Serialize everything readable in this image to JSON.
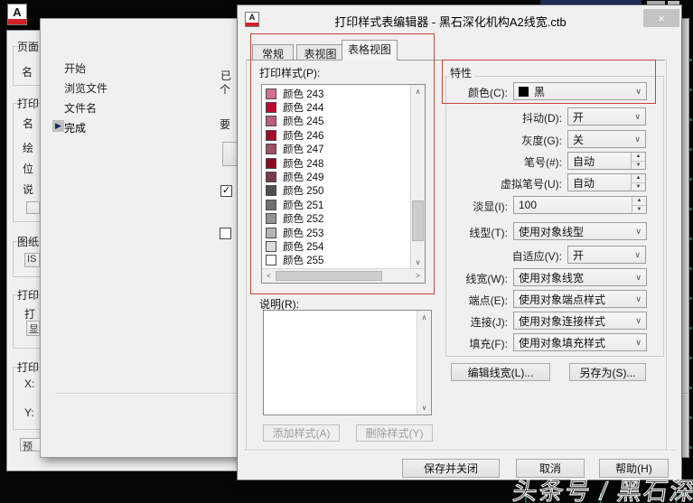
{
  "colors": {
    "annotation_red": "#c6443c",
    "dialog_bg": "#f0f0f0",
    "backdrop": "#060606",
    "tick_green": "#1d5f53"
  },
  "icons": {
    "close": "×",
    "chevron_down": "∨",
    "chevron_up": "∧",
    "chevron_left": "<",
    "chevron_right": ">",
    "spin_up": "▲",
    "spin_down": "▼",
    "current_step_arrow": "▶",
    "checkmark": "✓",
    "black_swatch": "■",
    "app_letter": "A"
  },
  "watermark": "头条号 / 黑石深化",
  "editor_dialog": {
    "title": "打印样式表编辑器 - 黑石深化机构A2线宽.ctb",
    "tabs": [
      {
        "label": "常规",
        "active": false
      },
      {
        "label": "表视图",
        "active": false
      },
      {
        "label": "表格视图",
        "active": true
      }
    ],
    "plot_styles_label": "打印样式(P):",
    "styles": [
      {
        "name": "颜色 243",
        "swatch": "#d4708e"
      },
      {
        "name": "颜色 244",
        "swatch": "#bd0a30"
      },
      {
        "name": "颜色 245",
        "swatch": "#b95f77"
      },
      {
        "name": "颜色 246",
        "swatch": "#a60a28"
      },
      {
        "name": "颜色 247",
        "swatch": "#a04f62"
      },
      {
        "name": "颜色 248",
        "swatch": "#8c0a22"
      },
      {
        "name": "颜色 249",
        "swatch": "#7a3a46"
      },
      {
        "name": "颜色 250",
        "swatch": "#4f4f4f"
      },
      {
        "name": "颜色 251",
        "swatch": "#707070"
      },
      {
        "name": "颜色 252",
        "swatch": "#949494"
      },
      {
        "name": "颜色 253",
        "swatch": "#b5b5b5"
      },
      {
        "name": "颜色 254",
        "swatch": "#dcdcdc"
      },
      {
        "name": "颜色 255",
        "swatch": "#ffffff"
      }
    ],
    "description_label": "说明(R):",
    "description_value": "",
    "add_style_button": "添加样式(A)",
    "delete_style_button": "删除样式(Y)",
    "properties": {
      "group_label": "特性",
      "rows": [
        {
          "label": "颜色(C):",
          "value": "黑",
          "control": "color",
          "wide": true
        },
        {
          "label": "抖动(D):",
          "value": "开",
          "control": "dd",
          "wide": false
        },
        {
          "label": "灰度(G):",
          "value": "关",
          "control": "dd",
          "wide": false
        },
        {
          "label": "笔号(#):",
          "value": "自动",
          "control": "spin",
          "wide": false
        },
        {
          "label": "虚拟笔号(U):",
          "value": "自动",
          "control": "spin",
          "wide": false
        },
        {
          "label": "淡显(I):",
          "value": "100",
          "control": "spin",
          "wide": true
        },
        {
          "label": "线型(T):",
          "value": "使用对象线型",
          "control": "dd",
          "wide": true
        },
        {
          "label": "自适应(V):",
          "value": "开",
          "control": "dd",
          "wide": false
        },
        {
          "label": "线宽(W):",
          "value": "使用对象线宽",
          "control": "dd",
          "wide": true
        },
        {
          "label": "端点(E):",
          "value": "使用对象端点样式",
          "control": "dd",
          "wide": true
        },
        {
          "label": "连接(J):",
          "value": "使用对象连接样式",
          "control": "dd",
          "wide": true
        },
        {
          "label": "填充(F):",
          "value": "使用对象填充样式",
          "control": "dd",
          "wide": true
        }
      ],
      "edit_lineweight_button": "编辑线宽(L)...",
      "save_as_button": "另存为(S)..."
    },
    "footer": {
      "save_close_button": "保存并关闭",
      "cancel_button": "取消",
      "help_button": "帮助(H)"
    }
  },
  "wizard_dialog": {
    "steps": [
      {
        "label": "开始",
        "current": false
      },
      {
        "label": "浏览文件",
        "current": false
      },
      {
        "label": "文件名",
        "current": false
      },
      {
        "label": "完成",
        "current": true
      }
    ],
    "clipped_text": {
      "line1": "已",
      "line2": "个",
      "line3": "要"
    },
    "checkboxes": [
      {
        "checked": true
      },
      {
        "checked": false
      }
    ]
  },
  "page_setup_dialog": {
    "fragments": [
      {
        "label": "页面",
        "type": "group"
      },
      {
        "label": "名",
        "type": "label"
      },
      {
        "label": "打印",
        "type": "group"
      },
      {
        "label": "名",
        "type": "label"
      },
      {
        "label": "绘",
        "type": "label"
      },
      {
        "label": "位",
        "type": "label"
      },
      {
        "label": "说",
        "type": "label"
      },
      {
        "label": "",
        "type": "button"
      },
      {
        "label": "图纸",
        "type": "group"
      },
      {
        "label": "IS",
        "type": "button"
      },
      {
        "label": "打印",
        "type": "group"
      },
      {
        "label": "打",
        "type": "label"
      },
      {
        "label": "显",
        "type": "button"
      },
      {
        "label": "打印",
        "type": "group"
      },
      {
        "label": "X:",
        "type": "label"
      },
      {
        "label": "Y:",
        "type": "label"
      },
      {
        "label": "预览",
        "type": "button"
      }
    ]
  }
}
